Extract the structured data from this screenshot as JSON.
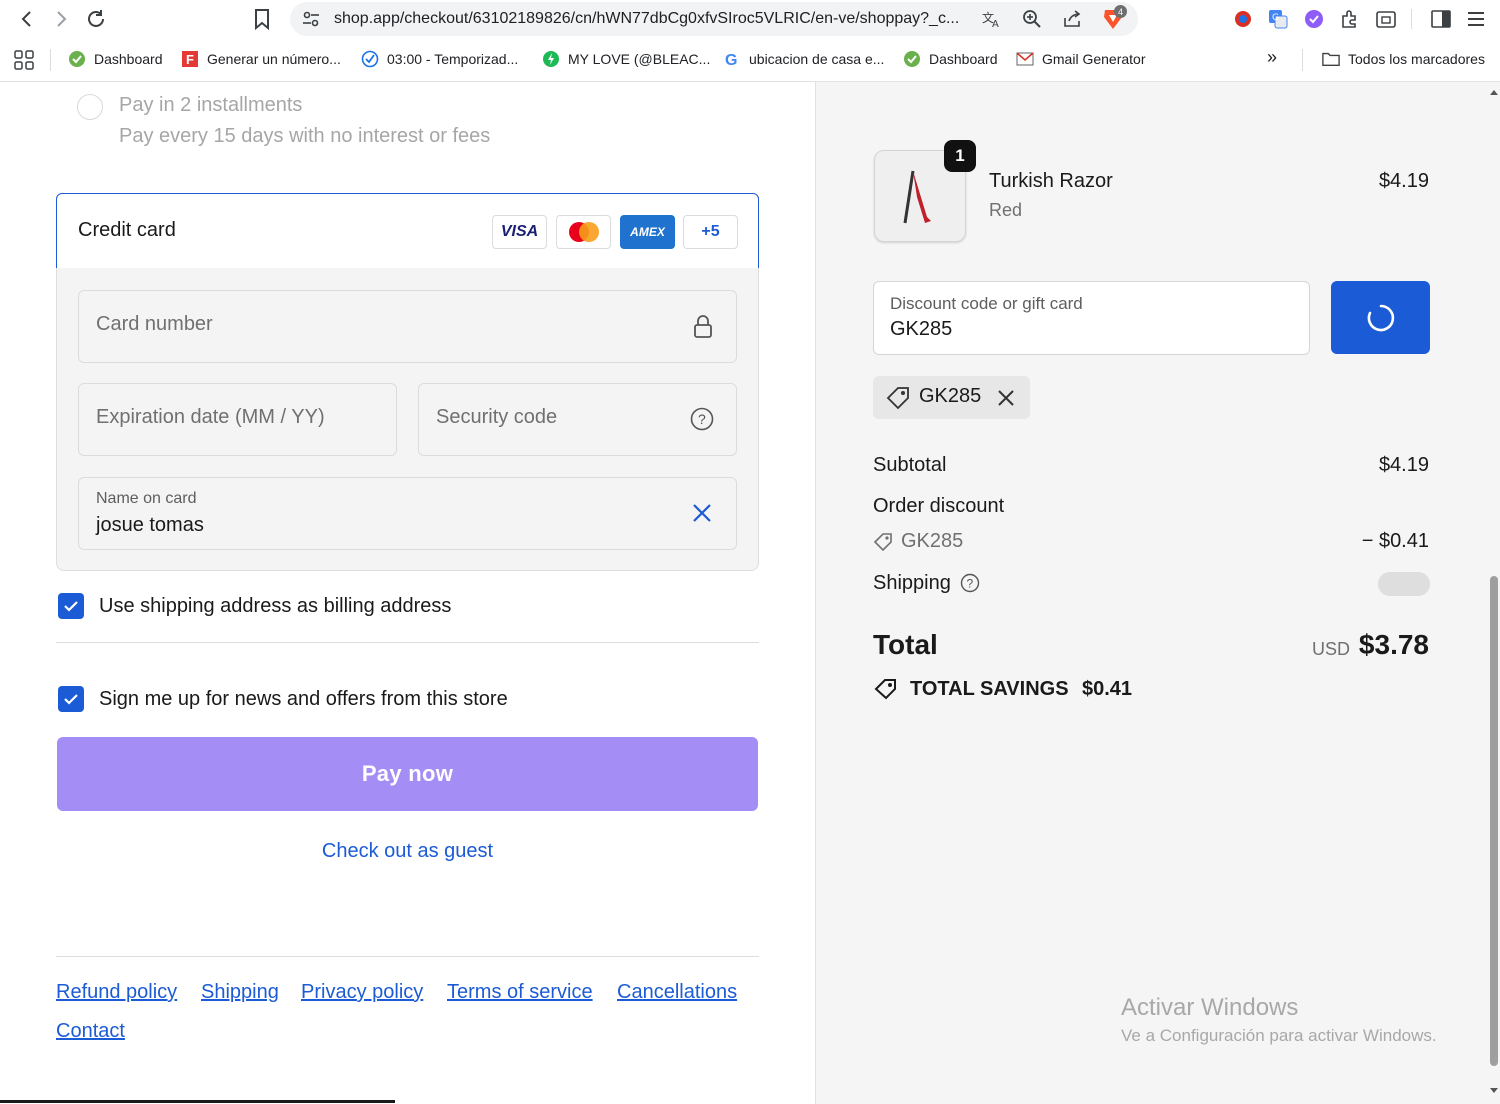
{
  "browser": {
    "url": "shop.app/checkout/63102189826/cn/hWN77dbCg0xfvSIroc5VLRIC/en-ve/shoppay?_c...",
    "bookmarks": [
      {
        "label": "Dashboard",
        "icon": "green-check-favicon"
      },
      {
        "label": "Generar un número...",
        "icon": "red-f-favicon"
      },
      {
        "label": "03:00 - Temporizad...",
        "icon": "blue-check-clock-favicon"
      },
      {
        "label": "MY LOVE (@BLEAC...",
        "icon": "green-bolt-favicon"
      },
      {
        "label": "ubicacion de casa e...",
        "icon": "google-g-favicon"
      },
      {
        "label": "Dashboard",
        "icon": "green-check-favicon"
      },
      {
        "label": "Gmail Generator",
        "icon": "mail-favicon"
      }
    ],
    "more_bookmarks": "»",
    "all_bookmarks": "Todos los marcadores",
    "extension_badge": "4"
  },
  "payment": {
    "installments_title": "Pay in 2 installments",
    "installments_desc": "Pay every 15 days with no interest or fees",
    "credit_card_title": "Credit card",
    "card_brands": [
      "VISA",
      "AMEX",
      "+5"
    ],
    "card_number_placeholder": "Card number",
    "expiration_placeholder": "Expiration date (MM / YY)",
    "security_placeholder": "Security code",
    "name_label": "Name on card",
    "name_value": "josue tomas",
    "billing_checkbox_label": "Use shipping address as billing address",
    "news_checkbox_label": "Sign me up for news and offers from this store",
    "pay_now": "Pay now",
    "guest_link": "Check out as guest"
  },
  "footer": {
    "links": [
      "Refund policy",
      "Shipping",
      "Privacy policy",
      "Terms of service",
      "Cancellations",
      "Contact"
    ]
  },
  "summary": {
    "quantity": "1",
    "product_name": "Turkish Razor",
    "product_variant": "Red",
    "product_price": "$4.19",
    "discount_label": "Discount code or gift card",
    "discount_value": "GK285",
    "applied_code": "GK285",
    "subtotal_label": "Subtotal",
    "subtotal_value": "$4.19",
    "order_discount_label": "Order discount",
    "discount_code": "GK285",
    "discount_amount": "− $0.41",
    "shipping_label": "Shipping",
    "total_label": "Total",
    "currency": "USD",
    "total_value": "$3.78",
    "savings_label": "TOTAL SAVINGS",
    "savings_value": "$0.41"
  },
  "watermark": {
    "title": "Activar Windows",
    "subtitle": "Ve a Configuración para activar Windows."
  },
  "colors": {
    "accent": "#1c5bd6",
    "pay_button": "#a48ef5",
    "summary_bg": "#f5f5f5"
  }
}
